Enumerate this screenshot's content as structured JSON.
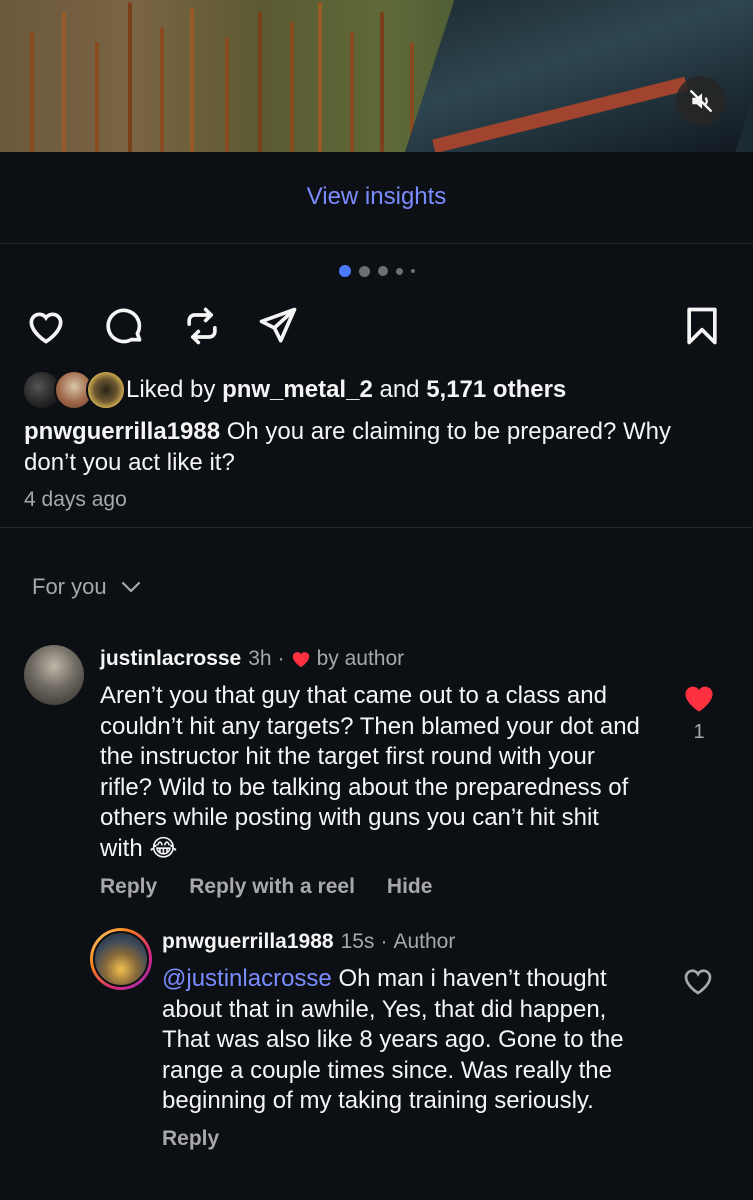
{
  "media": {
    "mute_icon": "speaker-muted-icon"
  },
  "insights": {
    "label": "View insights"
  },
  "carousel": {
    "count": 5,
    "active_index": 0
  },
  "actions": {
    "like_icon": "heart-icon",
    "comment_icon": "comment-bubble-icon",
    "repost_icon": "repost-icon",
    "share_icon": "paper-plane-icon",
    "save_icon": "bookmark-icon"
  },
  "likes": {
    "prefix": "Liked by",
    "user": "pnw_metal_2",
    "middle": "and",
    "others": "5,171 others"
  },
  "post": {
    "username": "pnwguerrilla1988",
    "caption": "Oh you are claiming to be prepared? Why don’t you act like it?",
    "time_ago": "4 days ago"
  },
  "comments_filter": {
    "label": "For you"
  },
  "comments": [
    {
      "username": "justinlacrosse",
      "time": "3h",
      "dot": "·",
      "liked_by_author": "by author",
      "text": "Aren’t you that guy that came out to a class and couldn’t hit any targets? Then blamed your dot and the instructor hit the target first round with your rifle? Wild to be talking about the preparedness of others while posting with guns you can’t hit shit with 😂",
      "like_count": "1",
      "actions": [
        "Reply",
        "Reply with a reel",
        "Hide"
      ],
      "colors": {
        "heart": "#ff3040"
      }
    },
    {
      "username": "pnwguerrilla1988",
      "time": "15s",
      "dot": "·",
      "author_badge": "Author",
      "mention": "@justinlacrosse",
      "text": "Oh man i haven’t thought about that in awhile, Yes, that did happen, That was also like 8 years ago. Gone to the range a couple times since. Was really the beginning of my taking training seriously.",
      "actions": [
        "Reply"
      ]
    }
  ],
  "colors": {
    "background": "#0c1014",
    "link": "#7b8cff",
    "muted": "#a8a8a8"
  }
}
